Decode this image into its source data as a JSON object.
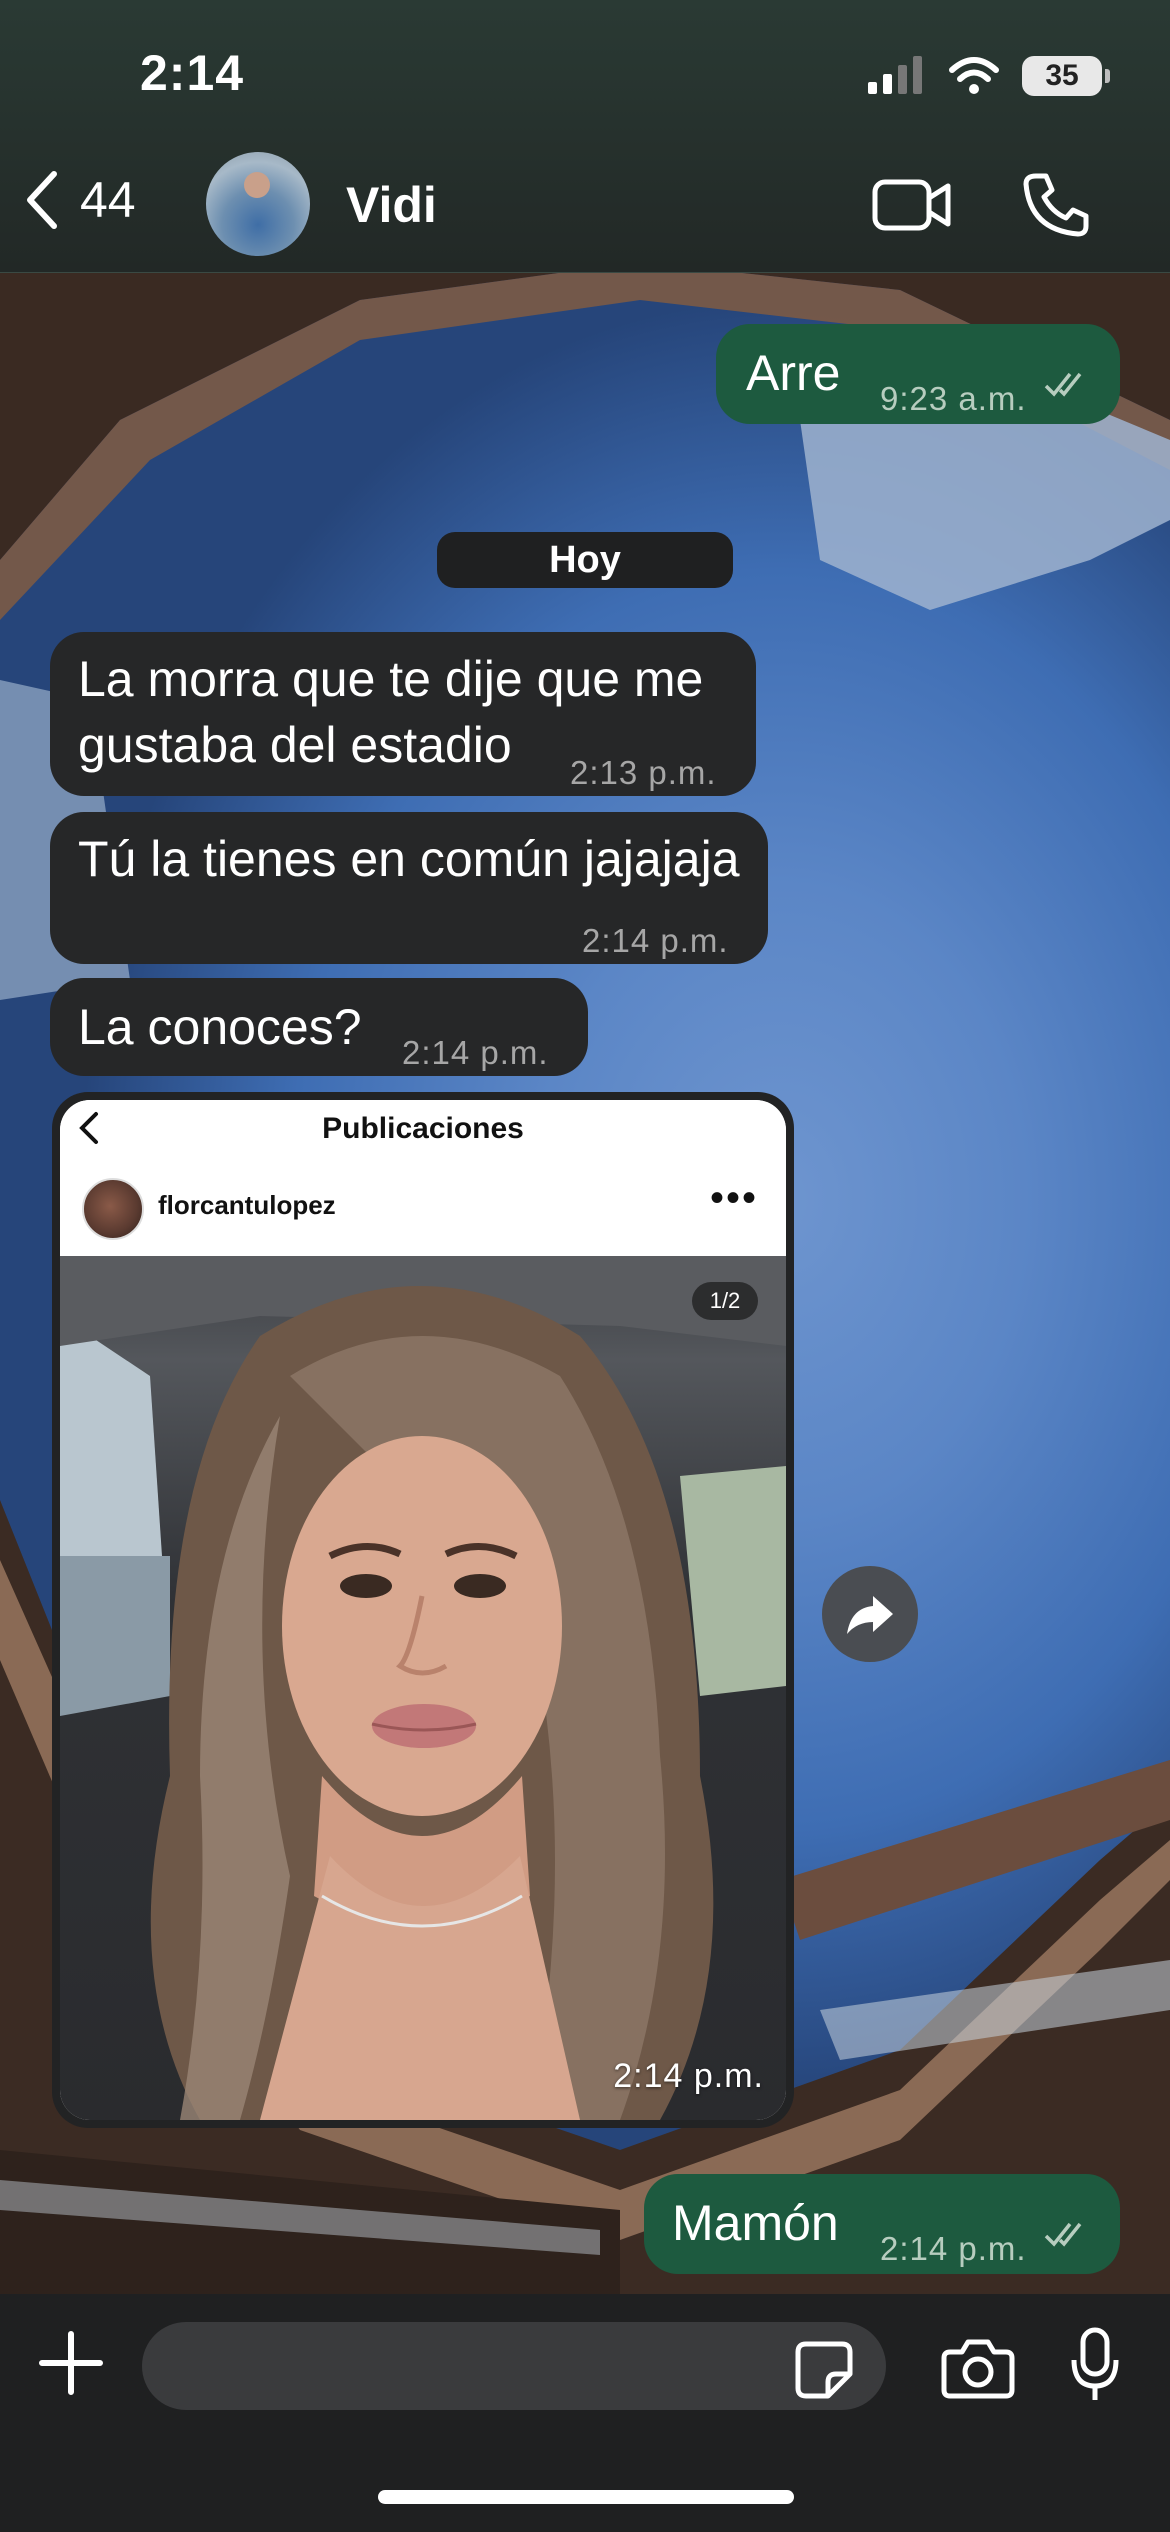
{
  "status_bar": {
    "time": "2:14",
    "battery": "35"
  },
  "header": {
    "back_count": "44",
    "contact_name": "Vidi"
  },
  "messages": [
    {
      "direction": "outgoing",
      "text": "Arre",
      "time": "9:23 a.m."
    },
    {
      "type": "date_separator",
      "text": "Hoy"
    },
    {
      "direction": "incoming",
      "text": "La morra que te dije que me gustaba del estadio",
      "time": "2:13 p.m."
    },
    {
      "direction": "incoming",
      "text": "Tú la tienes en común jajajaja",
      "time": "2:14 p.m."
    },
    {
      "direction": "incoming",
      "text": "La conoces?",
      "time": "2:14 p.m."
    },
    {
      "direction": "incoming",
      "type": "shared_post",
      "time": "2:14 p.m."
    },
    {
      "direction": "outgoing",
      "text": "Mamón",
      "time": "2:14 p.m."
    }
  ],
  "shared_post": {
    "screen_title": "Publicaciones",
    "username": "florcantulopez",
    "counter": "1/2",
    "time": "2:14 p.m."
  },
  "composer": {
    "placeholder": ""
  },
  "colors": {
    "incoming_bubble": "#262728",
    "outgoing_bubble": "#1d5a3f",
    "bar": "#1f2021"
  }
}
